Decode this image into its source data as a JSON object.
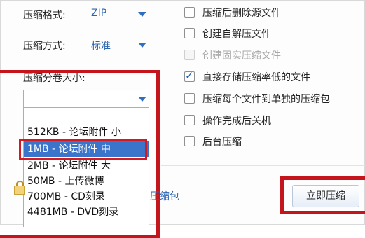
{
  "compression": {
    "format_label": "压缩格式:",
    "format_value": "ZIP",
    "method_label": "压缩方式:",
    "method_value": "标准",
    "split_label": "压缩分卷大小:",
    "split_value": ""
  },
  "split_options": [
    {
      "label": "512KB  - 论坛附件 小"
    },
    {
      "label": "1MB     - 论坛附件 中"
    },
    {
      "label": "2MB     - 论坛附件 大"
    },
    {
      "label": "50MB    - 上传微博"
    },
    {
      "label": "700MB   - CD刻录"
    },
    {
      "label": "4481MB - DVD刻录"
    }
  ],
  "selected_option_index": 1,
  "pack_link": "压缩包",
  "options": [
    {
      "label": "压缩后删除源文件",
      "checked": false,
      "disabled": false
    },
    {
      "label": "创建自解压文件",
      "checked": false,
      "disabled": false
    },
    {
      "label": "创建固实压缩文件",
      "checked": false,
      "disabled": true
    },
    {
      "label": "直接存储压缩率低的文件",
      "checked": true,
      "disabled": false
    },
    {
      "label": "压缩每个文件到单独的压缩包",
      "checked": false,
      "disabled": false
    },
    {
      "label": "操作完成后关机",
      "checked": false,
      "disabled": false
    },
    {
      "label": "后台压缩",
      "checked": false,
      "disabled": false
    }
  ],
  "start_button": "立即压缩",
  "colors": {
    "highlight_red": "#c4151c",
    "selection_blue": "#3b74cb",
    "value_blue": "#2c64b0"
  }
}
